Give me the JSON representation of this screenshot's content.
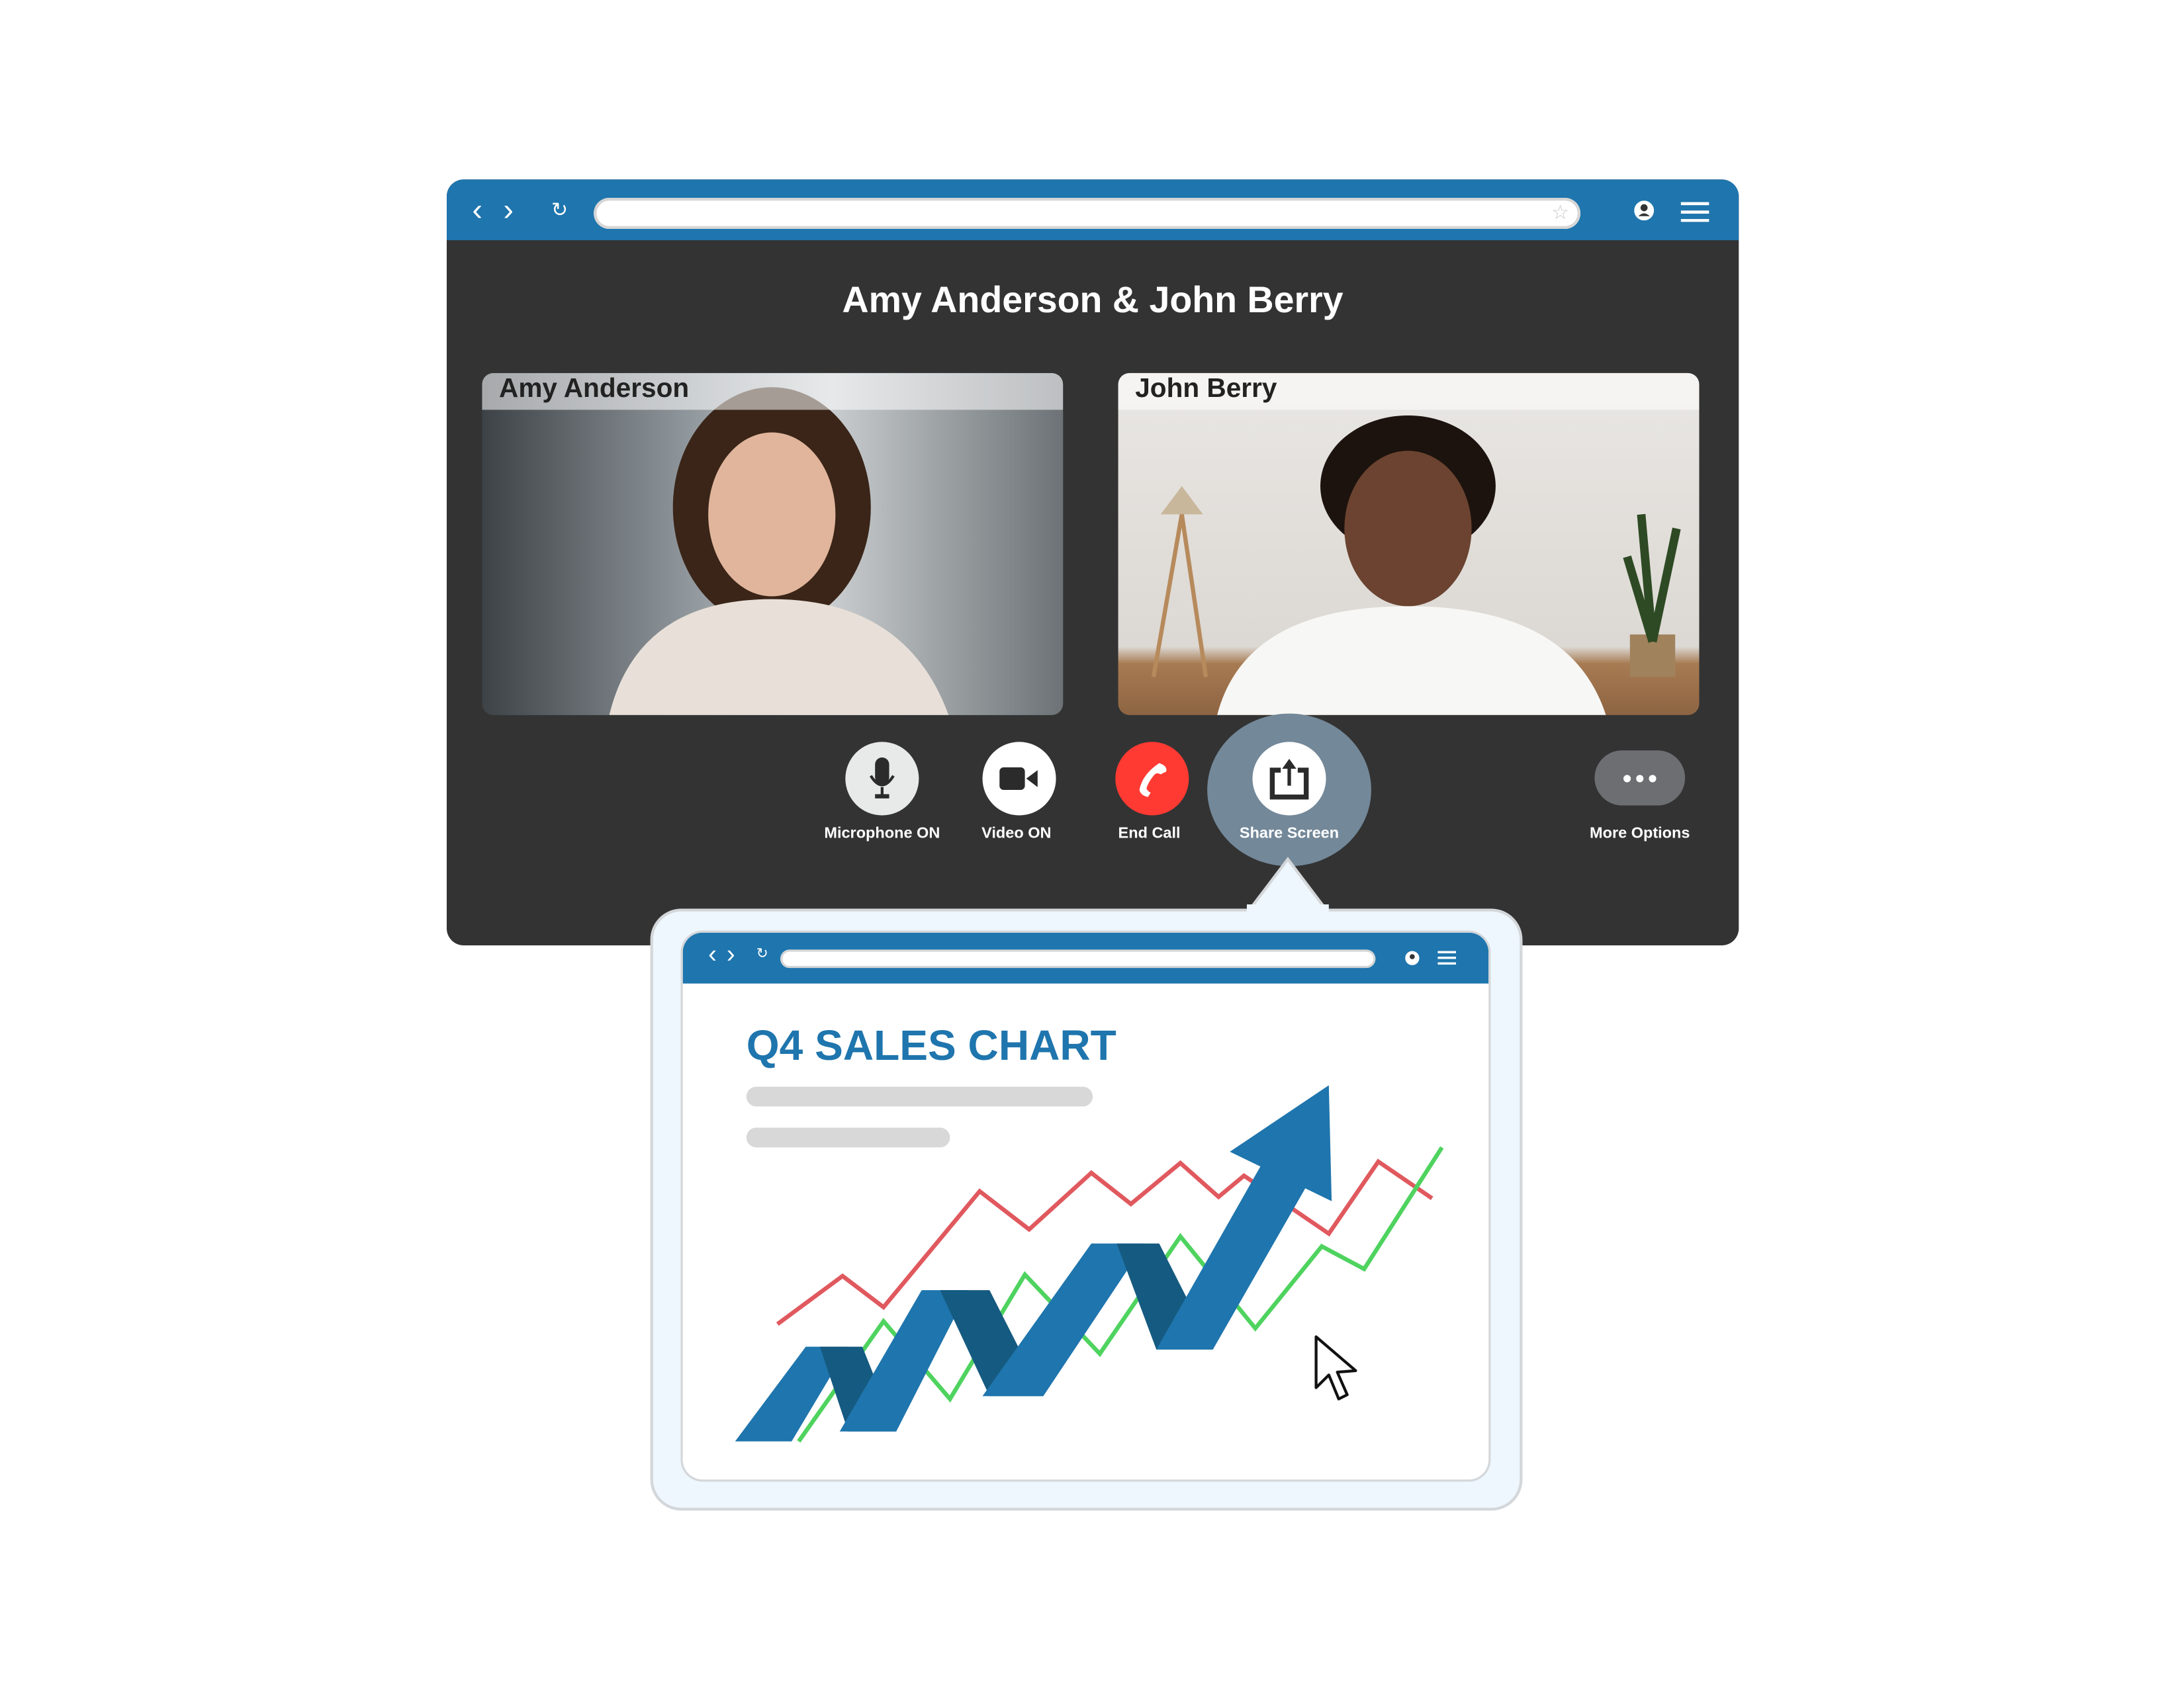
{
  "call": {
    "title": "Amy Anderson & John Berry",
    "participants": [
      {
        "name": "Amy Anderson"
      },
      {
        "name": "John Berry"
      }
    ],
    "controls": [
      {
        "label": "Microphone ON",
        "icon": "microphone-icon",
        "color": "#e8e9e9"
      },
      {
        "label": "Video ON",
        "icon": "video-camera-icon",
        "color": "#ffffff"
      },
      {
        "label": "End Call",
        "icon": "phone-icon",
        "color": "#ff3a33"
      },
      {
        "label": "Share Screen",
        "icon": "share-screen-icon",
        "color": "#ffffff",
        "active": true
      },
      {
        "label": "More Options",
        "icon": "more-dots-icon",
        "color": "#6d6e72"
      }
    ]
  },
  "shared_screen": {
    "title": "Q4 SALES CHART"
  },
  "colors": {
    "browser_bar": "#1f75ad",
    "call_background": "#333333",
    "share_highlight": "#738899",
    "popup_background": "#eef7fd",
    "red_line": "#e0595e",
    "green_line": "#4fd35f",
    "arrow_light": "#1f75ad",
    "arrow_dark": "#155a80"
  }
}
